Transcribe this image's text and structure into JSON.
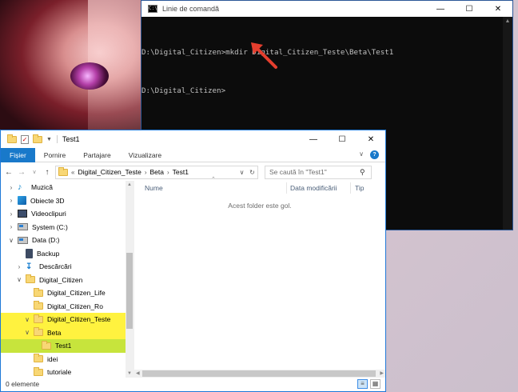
{
  "cmd": {
    "title": "Linie de comandă",
    "icon_text": "C:\\",
    "line1": "D:\\Digital_Citizen>mkdir Digital_Citizen_Teste\\Beta\\Test1",
    "line2": "D:\\Digital_Citizen>",
    "annotation_color": "#e53e2e"
  },
  "explorer": {
    "title": "Test1",
    "ribbon_tabs": [
      "Fișier",
      "Pornire",
      "Partajare",
      "Vizualizare"
    ],
    "address": {
      "prefix": "«",
      "crumbs": [
        "Digital_Citizen_Teste",
        "Beta",
        "Test1"
      ]
    },
    "search_placeholder": "Se caută în \"Test1\"",
    "tree": [
      {
        "label": "Muzică"
      },
      {
        "label": "Obiecte 3D"
      },
      {
        "label": "Videoclipuri"
      },
      {
        "label": "System (C:)"
      },
      {
        "label": "Data (D:)"
      },
      {
        "label": "Backup"
      },
      {
        "label": "Descărcări"
      },
      {
        "label": "Digital_Citizen"
      },
      {
        "label": "Digital_Citizen_Life"
      },
      {
        "label": "Digital_Citizen_Ro"
      },
      {
        "label": "Digital_Citizen_Teste"
      },
      {
        "label": "Beta"
      },
      {
        "label": "Test1"
      },
      {
        "label": "idei"
      },
      {
        "label": "tutoriale"
      }
    ],
    "columns": [
      "Nume",
      "Data modificării",
      "Tip"
    ],
    "empty_message": "Acest folder este gol.",
    "status": "0 elemente",
    "highlight_color": "#fff23f",
    "selected_color": "#c7e43c"
  }
}
